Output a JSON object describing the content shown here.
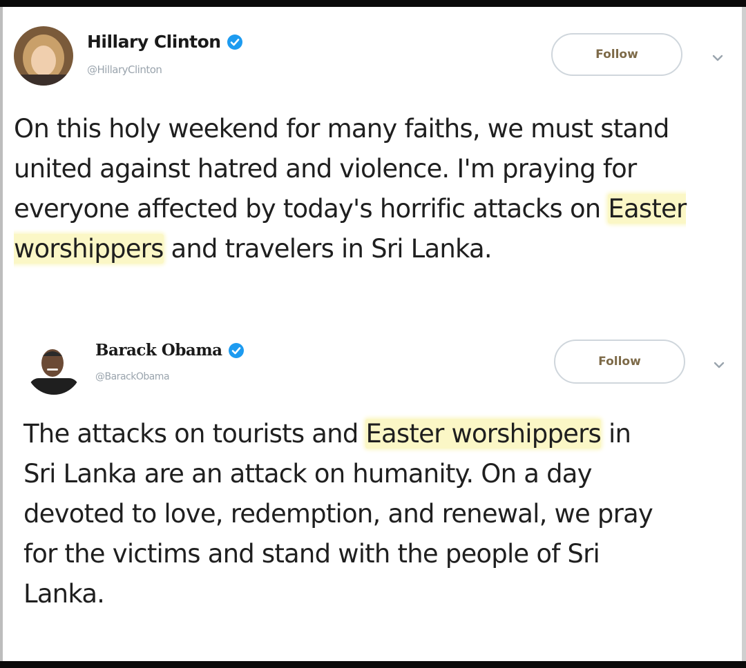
{
  "tweets": [
    {
      "author": {
        "name": "Hillary Clinton",
        "handle": "@HillaryClinton",
        "verified": true
      },
      "follow_label": "Follow",
      "text": {
        "before": "On this holy weekend for many faiths, we must stand united against hatred and violence. I'm praying for everyone affected by today's horrific attacks on ",
        "highlight": "Easter worshippers",
        "after": " and travelers in Sri Lanka."
      }
    },
    {
      "author": {
        "name": "Barack Obama",
        "handle": "@BarackObama",
        "verified": true
      },
      "follow_label": "Follow",
      "text": {
        "before": "The attacks on tourists and ",
        "highlight": "Easter worshippers",
        "after": " in Sri Lanka are an attack on humanity. On a day devoted to love, redemption, and renewal, we pray for the victims and stand with the people of Sri Lanka."
      }
    }
  ],
  "colors": {
    "verified_badge": "#1d9bf0",
    "highlight": "#fbf7c6",
    "follow_text": "#7d6a48",
    "follow_border": "#cfd6dc",
    "handle_text": "#9aa4ad"
  },
  "icons": {
    "verified": "verified-badge-icon",
    "more": "chevron-down-icon"
  }
}
